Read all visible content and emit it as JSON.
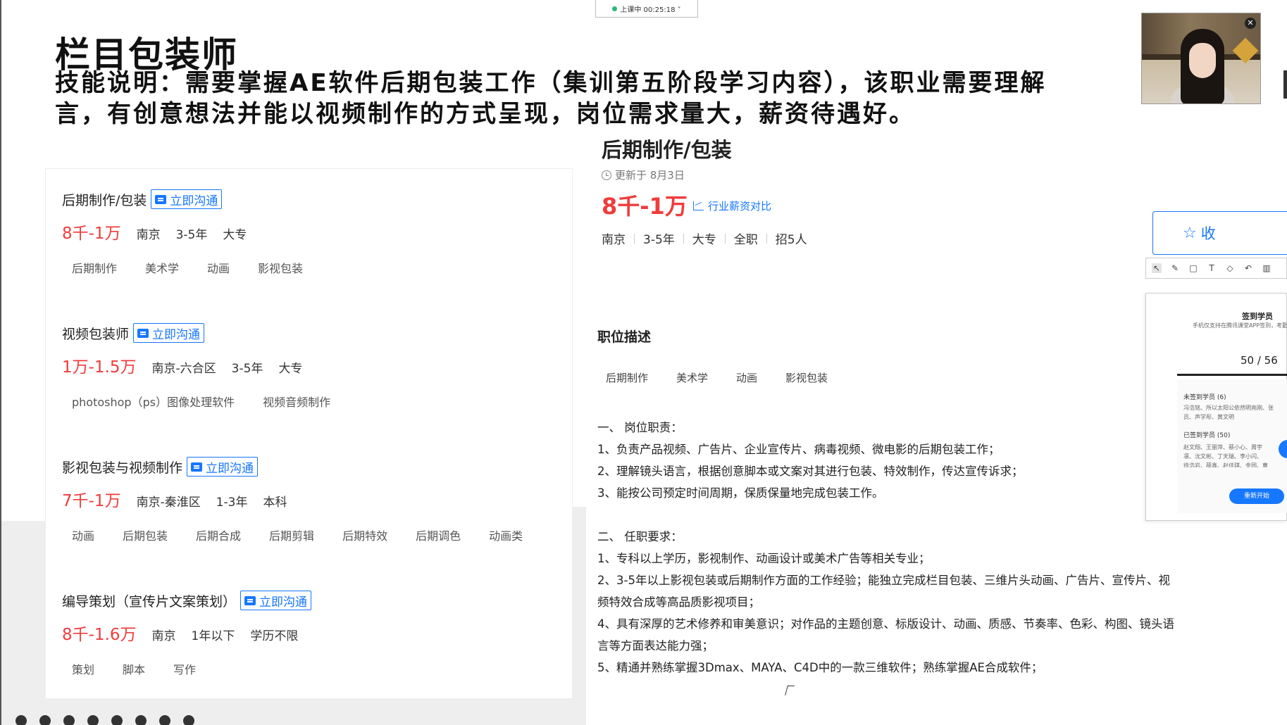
{
  "slide": {
    "title": "栏目包装师",
    "desc_line1": "技能说明：需要掌握AE软件后期包装工作（集训第五阶段学习内容），该职业需要理解",
    "desc_line2": "言，有创意想法并能以视频制作的方式呈现，岗位需求量大，薪资待遇好。"
  },
  "recording": {
    "label": "上课中 00:25:18 ˅"
  },
  "webcam": {
    "close_label": "✕"
  },
  "job_list": [
    {
      "title": "后期制作/包装",
      "chat_label": "立即沟通",
      "salary": "8千-1万",
      "location": "南京",
      "experience": "3-5年",
      "education": "大专",
      "tags": [
        "后期制作",
        "美术学",
        "动画",
        "影视包装"
      ]
    },
    {
      "title": "视频包装师",
      "chat_label": "立即沟通",
      "salary": "1万-1.5万",
      "location": "南京-六合区",
      "experience": "3-5年",
      "education": "大专",
      "tags": [
        "photoshop（ps）图像处理软件",
        "视频音频制作"
      ]
    },
    {
      "title": "影视包装与视频制作",
      "chat_label": "立即沟通",
      "salary": "7千-1万",
      "location": "南京-秦淮区",
      "experience": "1-3年",
      "education": "本科",
      "tags": [
        "动画",
        "后期包装",
        "后期合成",
        "后期剪辑",
        "后期特效",
        "后期调色",
        "动画类"
      ]
    },
    {
      "title": "编导策划（宣传片文案策划）",
      "chat_label": "立即沟通",
      "salary": "8千-1.6万",
      "location": "南京",
      "experience": "1年以下",
      "education": "学历不限",
      "tags": [
        "策划",
        "脚本",
        "写作"
      ]
    }
  ],
  "detail": {
    "title": "后期制作/包装",
    "updated": "更新于 8月3日",
    "salary": "8千-1万",
    "compare_label": "行业薪资对比",
    "meta": [
      "南京",
      "3-5年",
      "大专",
      "全职",
      "招5人"
    ],
    "section_title": "职位描述",
    "tags": [
      "后期制作",
      "美术学",
      "动画",
      "影视包装"
    ],
    "duties_heading": "一、 岗位职责：",
    "duties": [
      "1、负责产品视频、广告片、企业宣传片、病毒视频、微电影的后期包装工作；",
      "2、理解镜头语言，根据创意脚本或文案对其进行包装、特效制作，传达宣传诉求；",
      "3、能按公司预定时间周期，保质保量地完成包装工作。"
    ],
    "req_heading": "二、 任职要求：",
    "reqs": [
      "1、专科以上学历，影视制作、动画设计或美术广告等相关专业；",
      "2、3-5年以上影视包装或后期制作方面的工作经验；能独立完成栏目包装、三维片头动画、广告片、宣传片、视",
      "频特效合成等高品质影视项目；",
      "4、具有深厚的艺术修养和审美意识；对作品的主题创意、标版设计、动画、质感、节奏率、色彩、构图、镜头语",
      "言等方面表达能力强；",
      "5、精通并熟练掌握3Dmax、MAYA、C4D中的一款三维软件；熟练掌握AE合成软件；"
    ]
  },
  "fav": {
    "label": "收"
  },
  "signin": {
    "title": "签到学员",
    "subtitle": "手机仅支持在腾讯课堂APP签到，考勤中",
    "count": "50 / 56",
    "unsigned_heading": "未签到学员 (6)",
    "unsigned_line1": "冯浩铭、所以太阳公依然明亮刚、张",
    "unsigned_line2": "员、声学彤、黄文明",
    "signed_heading": "已签到学员 (50)",
    "signed_line1": "赵文翔、王丽萍、蔡小心、周宇",
    "signed_line2": "凛、沈文彬、丁天瑞、李小闪、",
    "signed_line3": "徐浩岩、薛鑫、赵佳琪、金园、曹",
    "restart_label": "重新开始"
  },
  "colors": {
    "accent": "#1677ff",
    "salary": "#f03c3c"
  }
}
